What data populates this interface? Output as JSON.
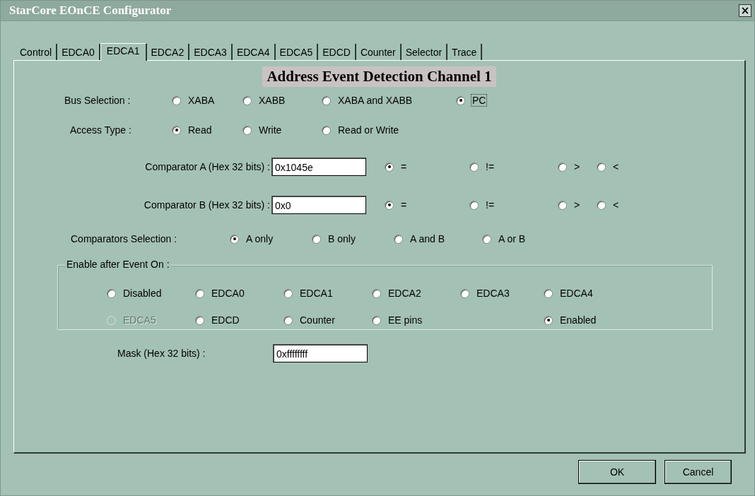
{
  "window": {
    "title": "StarCore EOnCE Configurator",
    "close": "×"
  },
  "tabs": [
    {
      "label": "Control",
      "selected": false
    },
    {
      "label": "EDCA0",
      "selected": false
    },
    {
      "label": "EDCA1",
      "selected": true
    },
    {
      "label": "EDCA2",
      "selected": false
    },
    {
      "label": "EDCA3",
      "selected": false
    },
    {
      "label": "EDCA4",
      "selected": false
    },
    {
      "label": "EDCA5",
      "selected": false
    },
    {
      "label": "EDCD",
      "selected": false
    },
    {
      "label": "Counter",
      "selected": false
    },
    {
      "label": "Selector",
      "selected": false
    },
    {
      "label": "Trace",
      "selected": false
    }
  ],
  "heading": "Address Event Detection Channel 1",
  "bus_selection": {
    "label": "Bus Selection :",
    "options": [
      {
        "label": "XABA",
        "selected": false,
        "focused": false
      },
      {
        "label": "XABB",
        "selected": false,
        "focused": false
      },
      {
        "label": "XABA and XABB",
        "selected": false,
        "focused": false
      },
      {
        "label": "PC",
        "selected": true,
        "focused": true
      }
    ]
  },
  "access_type": {
    "label": "Access Type :",
    "options": [
      {
        "label": "Read",
        "selected": true
      },
      {
        "label": "Write",
        "selected": false
      },
      {
        "label": "Read or Write",
        "selected": false
      }
    ]
  },
  "comparators": [
    {
      "label": "Comparator A (Hex 32 bits) :",
      "value": "0x1045e",
      "operators": [
        {
          "label": "=",
          "selected": true
        },
        {
          "label": "!=",
          "selected": false
        },
        {
          "label": ">",
          "selected": false
        },
        {
          "label": "<",
          "selected": false
        }
      ]
    },
    {
      "label": "Comparator B (Hex 32 bits) :",
      "value": "0x0",
      "operators": [
        {
          "label": "=",
          "selected": true
        },
        {
          "label": "!=",
          "selected": false
        },
        {
          "label": ">",
          "selected": false
        },
        {
          "label": "<",
          "selected": false
        }
      ]
    }
  ],
  "comparators_selection": {
    "label": "Comparators Selection :",
    "options": [
      {
        "label": "A only",
        "selected": true
      },
      {
        "label": "B only",
        "selected": false
      },
      {
        "label": "A and B",
        "selected": false
      },
      {
        "label": "A or B",
        "selected": false
      }
    ]
  },
  "enable_after_event": {
    "label": "Enable after Event On :",
    "rows": [
      [
        {
          "label": "Disabled",
          "selected": false,
          "disabled": false
        },
        {
          "label": "EDCA0",
          "selected": false,
          "disabled": false
        },
        {
          "label": "EDCA1",
          "selected": false,
          "disabled": false
        },
        {
          "label": "EDCA2",
          "selected": false,
          "disabled": false
        },
        {
          "label": "EDCA3",
          "selected": false,
          "disabled": false
        },
        {
          "label": "EDCA4",
          "selected": false,
          "disabled": false
        }
      ],
      [
        {
          "label": "EDCA5",
          "selected": false,
          "disabled": true
        },
        {
          "label": "EDCD",
          "selected": false,
          "disabled": false
        },
        {
          "label": "Counter",
          "selected": false,
          "disabled": false
        },
        {
          "label": "EE pins",
          "selected": false,
          "disabled": false
        },
        "",
        {
          "label": "Enabled",
          "selected": true,
          "disabled": false
        }
      ]
    ]
  },
  "mask": {
    "label": "Mask (Hex 32 bits) :",
    "value": "0xffffffff"
  },
  "buttons": [
    "OK",
    "Cancel"
  ]
}
